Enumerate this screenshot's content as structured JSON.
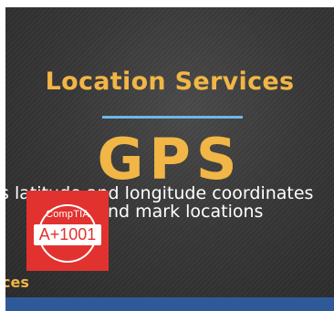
{
  "slide": {
    "title": "Location Services",
    "heading": "GPS",
    "line1": "s latitude and longitude coordinates",
    "line2": "nd mark locations",
    "corner_text": "ces"
  },
  "badge": {
    "brand": "CompTIA",
    "code": "A+1001"
  },
  "colors": {
    "accent": "#f1b646",
    "divider": "#6fb7e3",
    "badge": "#e2322f",
    "bar": "#2e5a98"
  }
}
